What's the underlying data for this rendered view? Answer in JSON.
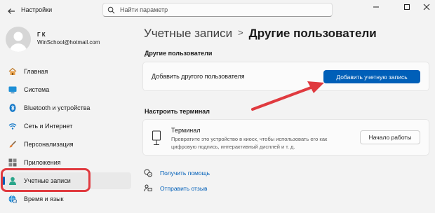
{
  "titlebar": {
    "app_title": "Настройки",
    "search_placeholder": "Найти параметр",
    "controls": [
      "minimize-icon",
      "maximize-icon",
      "close-icon"
    ]
  },
  "user": {
    "initials": "Г К",
    "email": "WinSchool@hotmail.com"
  },
  "sidebar": {
    "items": [
      {
        "label": "Главная",
        "icon": "home-icon"
      },
      {
        "label": "Система",
        "icon": "system-icon"
      },
      {
        "label": "Bluetooth и устройства",
        "icon": "bluetooth-icon"
      },
      {
        "label": "Сеть и Интернет",
        "icon": "wifi-icon"
      },
      {
        "label": "Персонализация",
        "icon": "brush-icon"
      },
      {
        "label": "Приложения",
        "icon": "apps-icon"
      },
      {
        "label": "Учетные записи",
        "icon": "person-icon",
        "active": true
      },
      {
        "label": "Время и язык",
        "icon": "globe-clock-icon"
      }
    ]
  },
  "main": {
    "breadcrumb_parent": "Учетные записи",
    "breadcrumb_sep": ">",
    "breadcrumb_current": "Другие пользователи",
    "other_users": {
      "heading": "Другие пользователи",
      "text": "Добавить другого пользователя",
      "button": "Добавить учетную запись"
    },
    "kiosk": {
      "heading": "Настроить терминал",
      "title": "Терминал",
      "description_line1": "Превратите это устройство в киоск, чтобы использовать его как",
      "description_line2": "цифровую подпись, интерактивный дисплей и т. д.",
      "button": "Начало работы"
    },
    "links": [
      {
        "label": "Получить помощь",
        "icon": "help-icon"
      },
      {
        "label": "Отправить отзыв",
        "icon": "feedback-icon"
      }
    ]
  },
  "colors": {
    "accent": "#005fb8",
    "annotation": "#e03a3f"
  }
}
